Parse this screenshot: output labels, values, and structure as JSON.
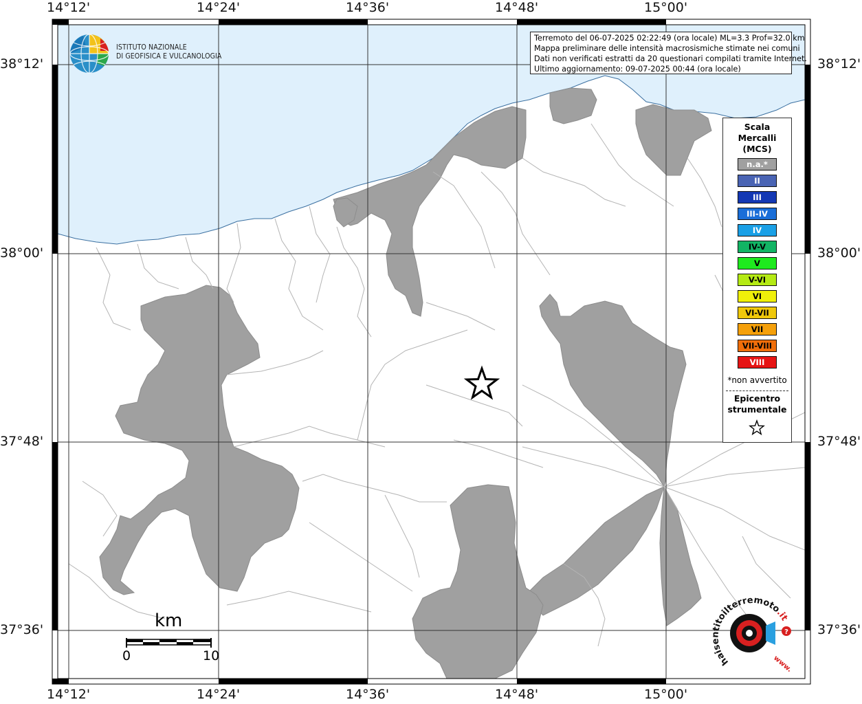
{
  "map": {
    "lon_ticks": [
      "14°12'",
      "14°24'",
      "14°36'",
      "14°48'",
      "15°00'"
    ],
    "lat_ticks": [
      "38°12'",
      "38°00'",
      "37°48'",
      "37°36'"
    ]
  },
  "header": {
    "org_line1": "ISTITUTO NAZIONALE",
    "org_line2": "DI GEOFISICA E VULCANOLOGIA"
  },
  "info": {
    "line1": "Terremoto del 06-07-2025 02:22:49 (ora locale) ML=3.3 Prof=32.0 km",
    "line2": "Mappa preliminare delle intensità macrosismiche stimate nei comuni",
    "line3": "Dati non verificati estratti da 20 questionari compilati tramite Internet.",
    "line4": "Ultimo aggiornamento: 09-07-2025 00:44 (ora locale)"
  },
  "legend": {
    "title_line1": "Scala",
    "title_line2": "Mercalli",
    "title_line3": "(MCS)",
    "classes": [
      {
        "label": "n.a.*",
        "color": "#a0a0a0",
        "text_color": "#ffffff"
      },
      {
        "label": "II",
        "color": "#4a64b4",
        "text_color": "#ffffff"
      },
      {
        "label": "III",
        "color": "#1438b4",
        "text_color": "#ffffff"
      },
      {
        "label": "III-IV",
        "color": "#1a6ed8",
        "text_color": "#ffffff"
      },
      {
        "label": "IV",
        "color": "#1aa0e6",
        "text_color": "#ffffff"
      },
      {
        "label": "IV-V",
        "color": "#12b464",
        "text_color": "#000000"
      },
      {
        "label": "V",
        "color": "#1eea1e",
        "text_color": "#000000"
      },
      {
        "label": "V-VI",
        "color": "#b4ea14",
        "text_color": "#000000"
      },
      {
        "label": "VI",
        "color": "#f0f00a",
        "text_color": "#000000"
      },
      {
        "label": "VI-VII",
        "color": "#f0c80a",
        "text_color": "#000000"
      },
      {
        "label": "VII",
        "color": "#f5a00a",
        "text_color": "#000000"
      },
      {
        "label": "VII-VIII",
        "color": "#f06e0a",
        "text_color": "#000000"
      },
      {
        "label": "VIII",
        "color": "#e61414",
        "text_color": "#ffffff"
      }
    ],
    "na_note": "*non avvertito",
    "epicenter_line1": "Epicentro",
    "epicenter_line2": "strumentale"
  },
  "scalebar": {
    "unit": "km",
    "start": "0",
    "end": "10"
  },
  "watermark": {
    "text_main": "haisentitoilterremoto",
    "text_it": ".it",
    "text_www": "www."
  },
  "colors": {
    "sea": "#dff0fc",
    "land": "#ffffff",
    "not_felt": "#a0a0a0",
    "boundaries": "#b4b4b4"
  }
}
